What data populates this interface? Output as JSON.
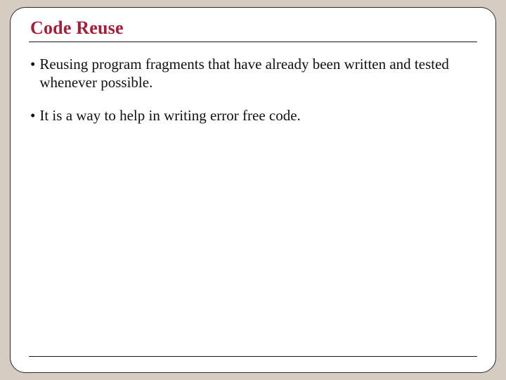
{
  "slide": {
    "title": "Code Reuse",
    "bullets": [
      "Reusing program fragments that have already been written and tested whenever possible.",
      "It is a way to help in writing error free code."
    ]
  },
  "colors": {
    "accent": "#a3203a",
    "background": "#d5cdc2",
    "card": "#ffffff",
    "rule": "#1a1a1a"
  }
}
